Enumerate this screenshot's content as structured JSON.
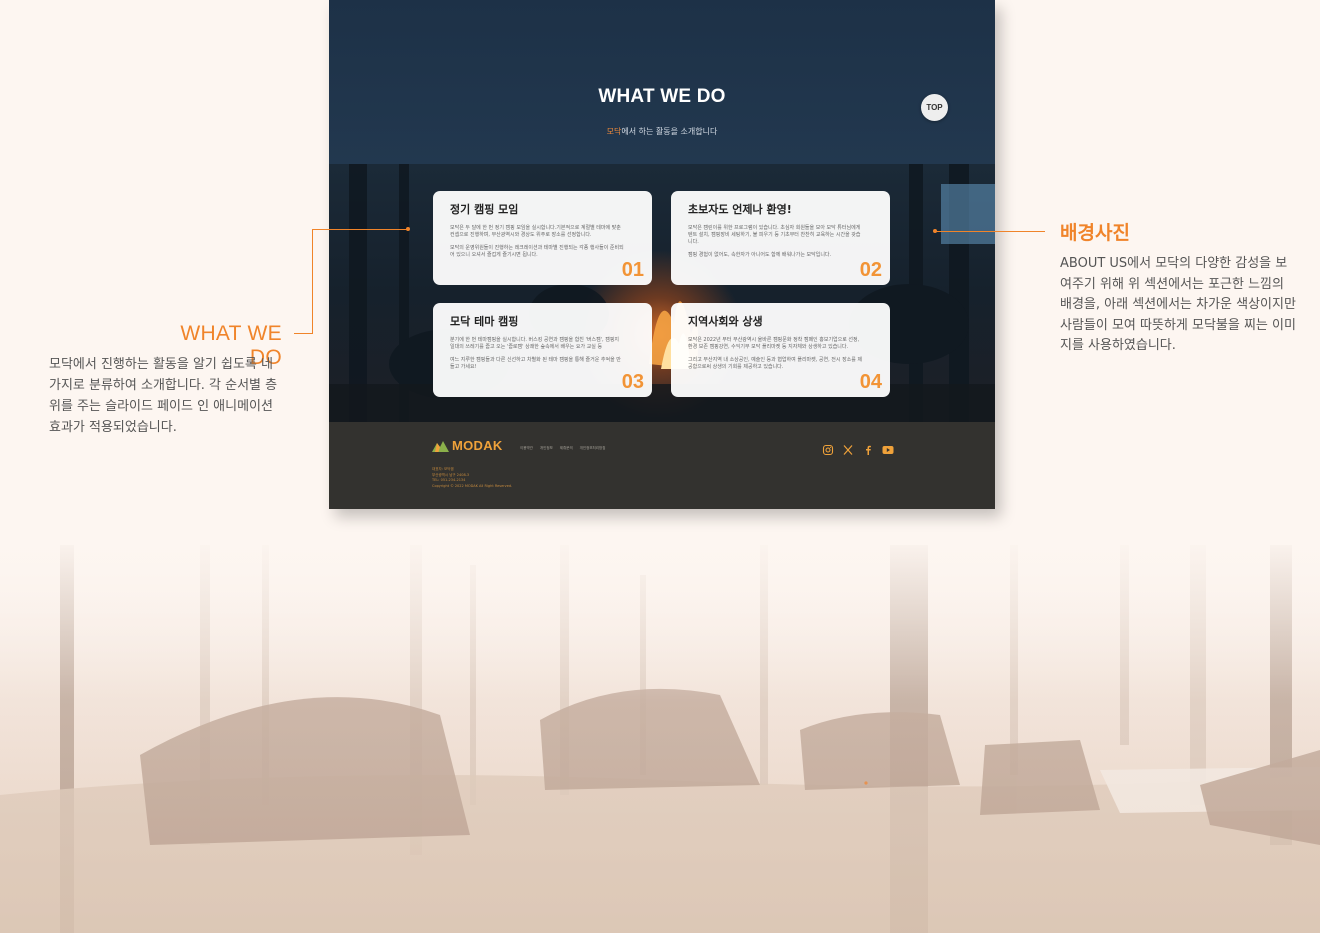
{
  "hero": {
    "title": "WHAT WE DO",
    "subtitle_accent": "모닥",
    "subtitle_rest": "에서 하는 활동을 소개합니다",
    "top_button": "TOP"
  },
  "cards": [
    {
      "title": "정기 캠핑 모임",
      "text1": "모닥은 두 달에 한 번 정기 캠핑 모임을 실시합니다.기본적으로 계절별 테마에 맞춘 컨셉으로 진행하며, 부산광역시와 경상도 위주로 장소를 선정합니다.",
      "text2": "모닥의 운영위원들이 진행하는 레크레이션과 테마별 진행되는 각종 행사들이 준비되어 있으니 오셔서 즐겁게 즐기시면 됩니다.",
      "number": "01"
    },
    {
      "title": "초보자도 언제나 환영!",
      "text1": "모닥은 캠린이를 위한 프로그램이 있습니다. 초심자 회원들을 모아 모닥 튜터님에게 텐트 설치, 캠핑장비 세팅하기, 불 피우기 등 기초부터 찬찬히 교육하는 시간을 갖습니다.",
      "text2": "캠핑 경험이 없어도, 속한자가 아니어도 함께 배워나가는 모닥입니다.",
      "number": "02"
    },
    {
      "title": "모닥 테마 캠핑",
      "text1": "분기에 한 번 테마캠핑을 실시합니다. 버스킹 공연과 캠핑을 합친 '버스캠', 캠핑지 일대의 쓰레기를 줍고 오는 '줍로캠' 상쾌한 숲속에서 배우는 요가 교실 등",
      "text2": "여느 지루한 캠핑들과 다른 신선하고 차별화 된 테마 캠핑을 통해 즐거운 추억을 만들고 가세요!",
      "number": "03"
    },
    {
      "title": "지역사회와 상생",
      "text1": "모닥은 2022년 부터 부산광역시 울바른 캠핑문화 정착 캠페인 홍보기업으로 선정, 환경 보존 캠핑강연, 수익기부 모닥 플리마켓 등 지자체와 상생하고 있습니다.",
      "text2": "그리고 부산지역 내 소상공인, 예술인 등과 협업하여 플리마켓, 공연, 전시 장소를 제공함으로써 상생의 기회를 제공하고 있습니다.",
      "number": "04"
    }
  ],
  "footer": {
    "logo": "MODAK",
    "nav": [
      "이용약관",
      "개인정보",
      "제휴문의",
      "개인정보처리방침"
    ],
    "info": [
      "대표자: 모닥캠",
      "부산광역시 남구 2408-3",
      "TEL: 051-234-2134",
      "Copyright © 2022 MODAK All Right Reserved."
    ],
    "social_icons": [
      "instagram-icon",
      "x-icon",
      "facebook-icon",
      "youtube-icon"
    ]
  },
  "annotations": {
    "left_title": "WHAT WE DO",
    "left_text": "모닥에서 진행하는 활동을 알기 쉽도록 네 가지로 분류하여 소개합니다. 각 순서별 층위를 주는 슬라이드 페이드 인 애니메이션 효과가 적용되었습니다.",
    "right_title": "배경사진",
    "right_text": "ABOUT US에서 모닥의 다양한 감성을 보여주기 위해 위 섹션에서는 포근한 느낌의 배경을, 아래 섹션에서는 차가운 색상이지만 사람들이 모여 따뜻하게 모닥불을 찌는 이미지를 사용하였습니다."
  },
  "colors": {
    "accent": "#f0842a",
    "card_number": "#f29436",
    "hero_bg": "#1d3147",
    "footer_bg": "#33322f",
    "page_bg": "#fdf6f1"
  }
}
